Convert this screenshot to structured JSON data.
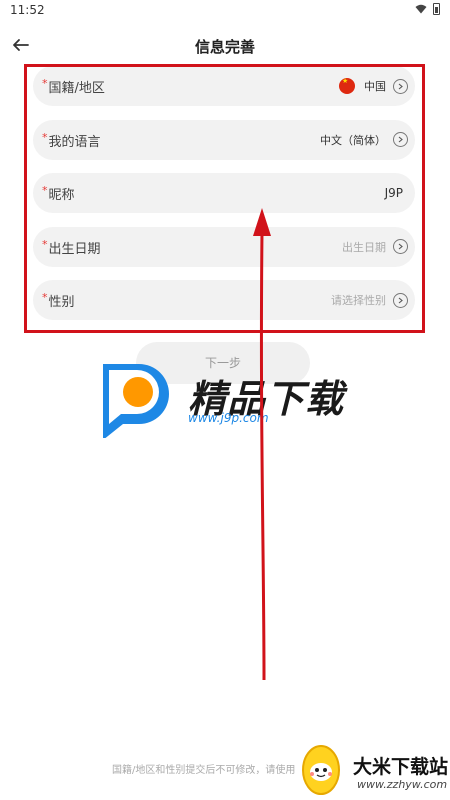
{
  "status": {
    "time": "11:52"
  },
  "header": {
    "title": "信息完善"
  },
  "form": {
    "rows": [
      {
        "label": "国籍/地区",
        "value": "中国",
        "required": "*"
      },
      {
        "label": "我的语言",
        "value": "中文（简体）",
        "required": "*"
      },
      {
        "label": "昵称",
        "value": "J9P",
        "required": "*"
      },
      {
        "label": "出生日期",
        "placeholder": "出生日期",
        "required": "*"
      },
      {
        "label": "性别",
        "placeholder": "请选择性别",
        "required": "*"
      }
    ]
  },
  "next_button": {
    "label": "下一步"
  },
  "footer": {
    "note": "国籍/地区和性别提交后不可修改，请使用"
  },
  "watermarks": {
    "brand1": "精品下载",
    "url1": "www.j9p.com",
    "brand2": "大米下载站",
    "url2": "www.zzhyw.com"
  },
  "colors": {
    "highlight": "#d1121a",
    "required": "#e53935",
    "row_bg": "#f2f2f2",
    "logo_blue": "#1e88e5",
    "logo_orange": "#ff9800"
  }
}
